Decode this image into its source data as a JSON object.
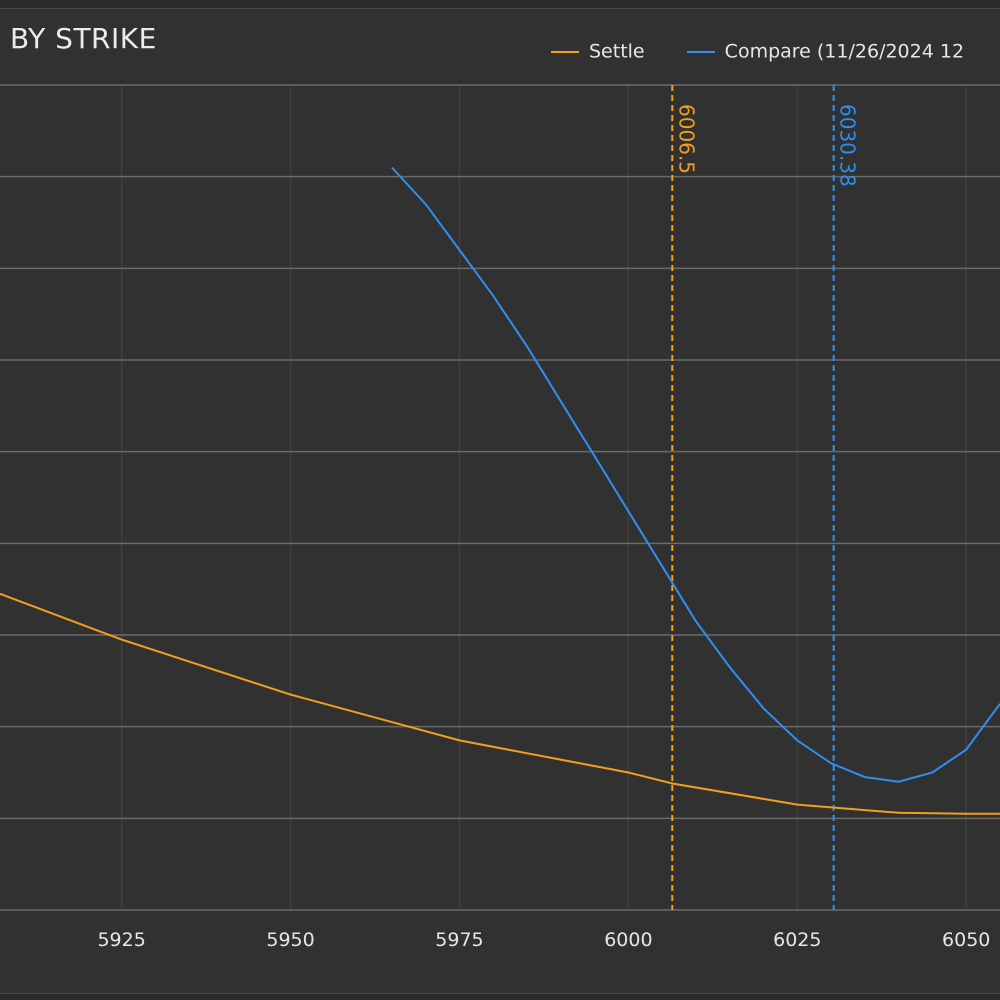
{
  "header": {
    "title": "BY STRIKE"
  },
  "legend": [
    {
      "label": "Settle",
      "color": "#f0a01e"
    },
    {
      "label": "Compare (11/26/2024 12",
      "color": "#2f8ff0"
    }
  ],
  "colors": {
    "background": "#313131",
    "grid": "#6a6a6a",
    "grid_minor": "#3f3f3f",
    "axis_text": "#e6e6e6"
  },
  "chart_data": {
    "type": "line",
    "title": "BY STRIKE",
    "xlabel": "",
    "ylabel": "",
    "xlim": [
      5907,
      6055
    ],
    "ylim": [
      0,
      9
    ],
    "grid": true,
    "legend_position": "top-right",
    "x_ticks": [
      5925,
      5950,
      5975,
      6000,
      6025,
      6050
    ],
    "y_gridlines": [
      0,
      1,
      2,
      3,
      4,
      5,
      6,
      7,
      8,
      9
    ],
    "series": [
      {
        "name": "Settle",
        "color": "#f0a01e",
        "points": [
          [
            5907,
            3.45
          ],
          [
            5925,
            2.95
          ],
          [
            5950,
            2.35
          ],
          [
            5975,
            1.85
          ],
          [
            6000,
            1.5
          ],
          [
            6006.5,
            1.38
          ],
          [
            6025,
            1.15
          ],
          [
            6040,
            1.06
          ],
          [
            6050,
            1.05
          ],
          [
            6055,
            1.05
          ]
        ]
      },
      {
        "name": "Compare (11/26/2024 12",
        "color": "#2f8ff0",
        "points": [
          [
            5965,
            8.1
          ],
          [
            5970,
            7.7
          ],
          [
            5975,
            7.2
          ],
          [
            5980,
            6.7
          ],
          [
            5985,
            6.15
          ],
          [
            5990,
            5.55
          ],
          [
            5995,
            4.95
          ],
          [
            6000,
            4.35
          ],
          [
            6005,
            3.75
          ],
          [
            6010,
            3.15
          ],
          [
            6015,
            2.65
          ],
          [
            6020,
            2.2
          ],
          [
            6025,
            1.85
          ],
          [
            6030,
            1.6
          ],
          [
            6035,
            1.45
          ],
          [
            6040,
            1.4
          ],
          [
            6045,
            1.5
          ],
          [
            6050,
            1.75
          ],
          [
            6055,
            2.25
          ]
        ]
      }
    ],
    "markers": [
      {
        "label": "6006.5",
        "x": 6006.5,
        "color": "#f0a01e"
      },
      {
        "label": "6030.38",
        "x": 6030.38,
        "color": "#2f8ff0"
      }
    ]
  }
}
